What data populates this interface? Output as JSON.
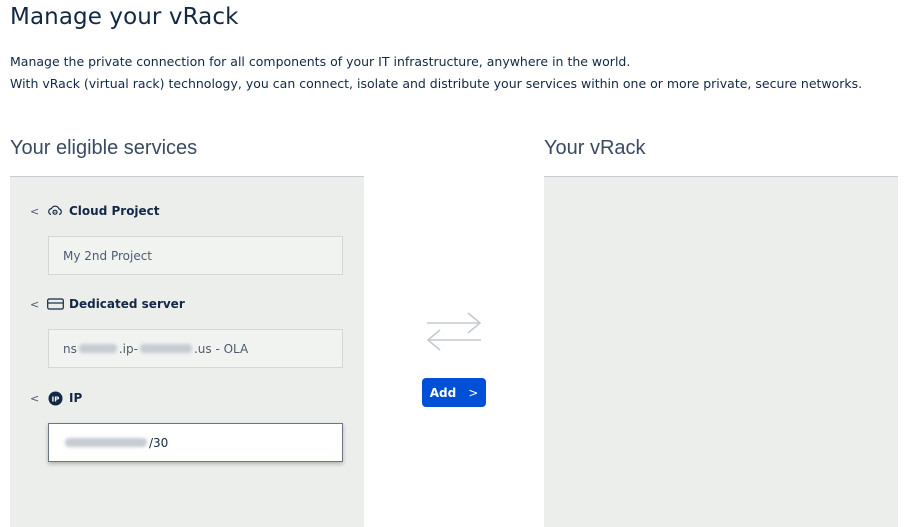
{
  "page": {
    "title": "Manage your vRack",
    "intro_line1": "Manage the private connection for all components of your IT infrastructure, anywhere in the world.",
    "intro_line2": "With vRack (virtual rack) technology, you can connect, isolate and distribute your services within one or more private, secure networks."
  },
  "eligible": {
    "title": "Your eligible services",
    "groups": [
      {
        "label": "Cloud Project",
        "icon": "cloud-project-icon",
        "chevron": "<",
        "items": [
          {
            "text": "My 2nd Project"
          }
        ]
      },
      {
        "label": "Dedicated server",
        "icon": "server-icon",
        "chevron": "<",
        "items": [
          {
            "prefix": "ns",
            "mid1": ".ip-",
            "suffix": ".us - OLA"
          }
        ]
      },
      {
        "label": "IP",
        "icon": "ip-icon",
        "chevron": "<",
        "items": [
          {
            "suffix": "/30",
            "selected": true
          }
        ]
      }
    ]
  },
  "vrack": {
    "title": "Your vRack"
  },
  "actions": {
    "add_label": "Add",
    "add_chevron": ">"
  },
  "colors": {
    "primary": "#0050d7",
    "text": "#122844",
    "panel": "#eceeec"
  }
}
